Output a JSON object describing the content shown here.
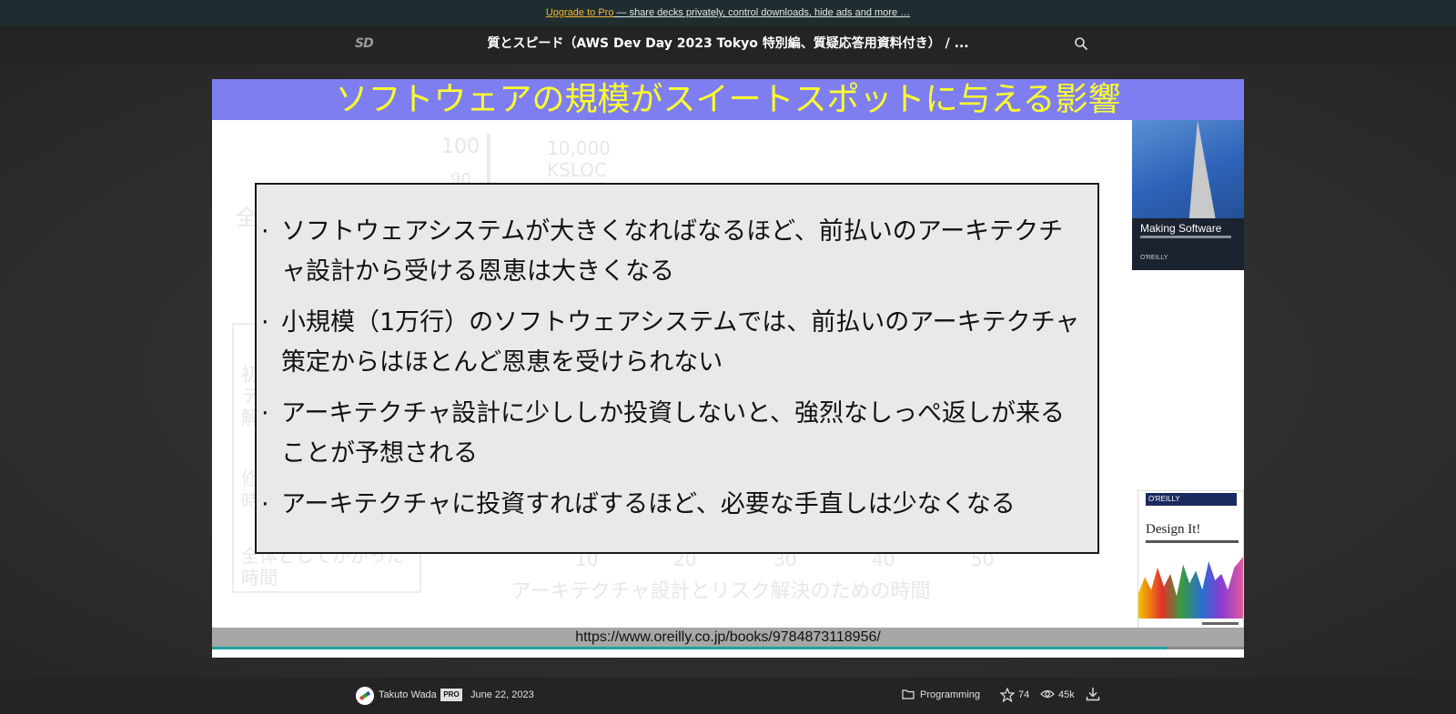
{
  "promo": {
    "link_text": "Upgrade to Pro",
    "rest_text": " — share decks privately, control downloads, hide ads and more …"
  },
  "header": {
    "logo_text": "SD",
    "title": "質とスピード（AWS Dev Day 2023 Tokyo 特別編、質疑応答用資料付き） / ..."
  },
  "slide": {
    "title": "ソフトウェアの規模がスイートスポットに与える影響",
    "background_chart": {
      "y_tick": "100",
      "y_tick_partial": "90",
      "series_label_1": "10,000",
      "series_label_2": "KSLOC",
      "left_label": "全",
      "x_ticks": [
        "10",
        "20",
        "30",
        "40",
        "50"
      ],
      "x_axis_label": "アーキテクチャ設計とリスク解決のための時間",
      "legend_items": [
        "初",
        "テ",
        "解",
        "修",
        "時",
        "全体としてかかった",
        "時間"
      ]
    },
    "bullets": [
      "ソフトウェアシステムが大きくなればなるほど、前払いのアーキテクチャ設計から受ける恩恵は大きくなる",
      "小規模（1万行）のソフトウェアシステムでは、前払いのアーキテクチャ策定からはほとんど恩恵を受けられない",
      "アーキテクチャ設計に少ししか投資しないと、強烈なしっぺ返しが来ることが予想される",
      "アーキテクチャに投資すればするほど、必要な手直しは少なくなる"
    ],
    "bullet_marker": "·",
    "book1": {
      "title": "Making Software",
      "publisher": "O'REILLY"
    },
    "book2": {
      "publisher": "O'REILLY",
      "title": "Design It!"
    },
    "footer_url": "https://www.oreilly.co.jp/books/9784873118956/",
    "progress": 0.925
  },
  "footer": {
    "author": "Takuto Wada",
    "badge": "PRO",
    "date": "June 22, 2023",
    "category": "Programming",
    "stars": "74",
    "views": "45k"
  },
  "colors": {
    "promo_bg": "#1f2d30",
    "promo_link": "#f2b72f",
    "title_bar": "#7f7ef0",
    "title_text": "#fbff2e",
    "progress": "#1fa2a5"
  },
  "icons": [
    "speakerdeck-logo-icon",
    "search-icon",
    "folder-icon",
    "star-icon",
    "eye-icon",
    "download-icon"
  ]
}
